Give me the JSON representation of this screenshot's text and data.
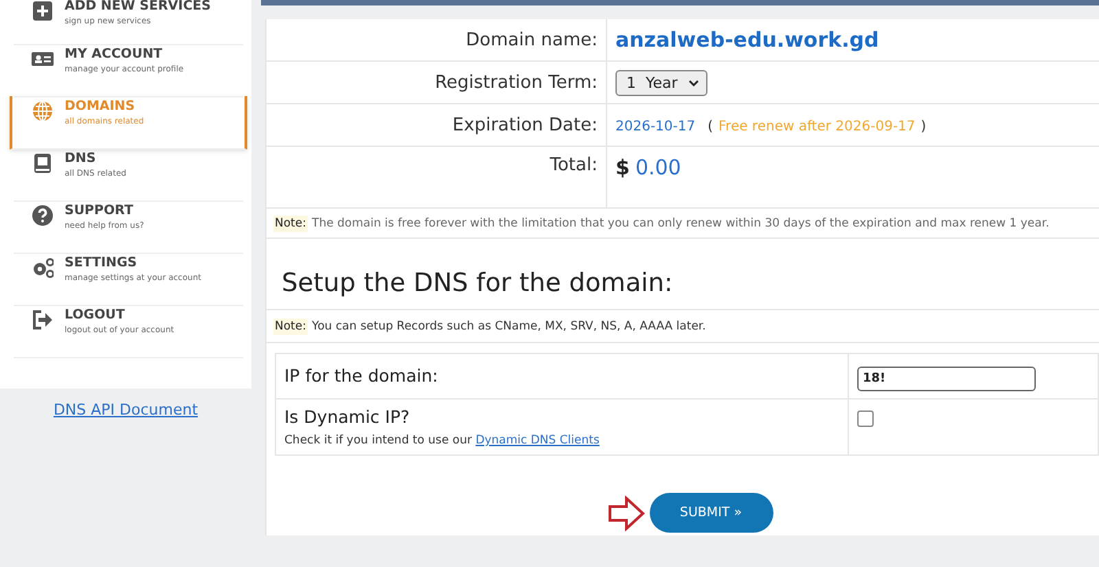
{
  "sidebar": {
    "items": [
      {
        "title": "ADD NEW SERVICES",
        "subtitle": "sign up new services",
        "selected": false
      },
      {
        "title": "MY ACCOUNT",
        "subtitle": "manage your account profile",
        "selected": false
      },
      {
        "title": "DOMAINS",
        "subtitle": "all domains related",
        "selected": true
      },
      {
        "title": "DNS",
        "subtitle": "all DNS related",
        "selected": false
      },
      {
        "title": "SUPPORT",
        "subtitle": "need help from us?",
        "selected": false
      },
      {
        "title": "SETTINGS",
        "subtitle": "manage settings at your account",
        "selected": false
      },
      {
        "title": "LOGOUT",
        "subtitle": "logout out of your account",
        "selected": false
      }
    ],
    "link": "DNS API Document"
  },
  "order": {
    "domain_label": "Domain name:",
    "domain": "anzalweb-edu.work.gd",
    "term_label": "Registration Term:",
    "term": "1  Year",
    "expiration_label": "Expiration Date:",
    "expiration": "2026-10-17",
    "renew_open": "(",
    "renew": "Free renew after 2026-09-17",
    "renew_close": ")",
    "total_label": "Total:",
    "currency": "$",
    "total": "0.00",
    "note_label": "Note:",
    "note": "The domain is free forever with the limitation that you can only renew within 30 days of the expiration and max renew 1 year."
  },
  "dns": {
    "heading": "Setup the DNS for the domain:",
    "note_label": "Note:",
    "note": "You can setup Records such as CName, MX, SRV, NS, A, AAAA later.",
    "ip_label": "IP for the domain:",
    "ip_value": "18!",
    "dynamic_label": "Is Dynamic IP?",
    "dynamic_checked": false,
    "hint": "Check it if you intend to use our",
    "hint_link": "Dynamic DNS Clients"
  },
  "submit": "SUBMIT »"
}
